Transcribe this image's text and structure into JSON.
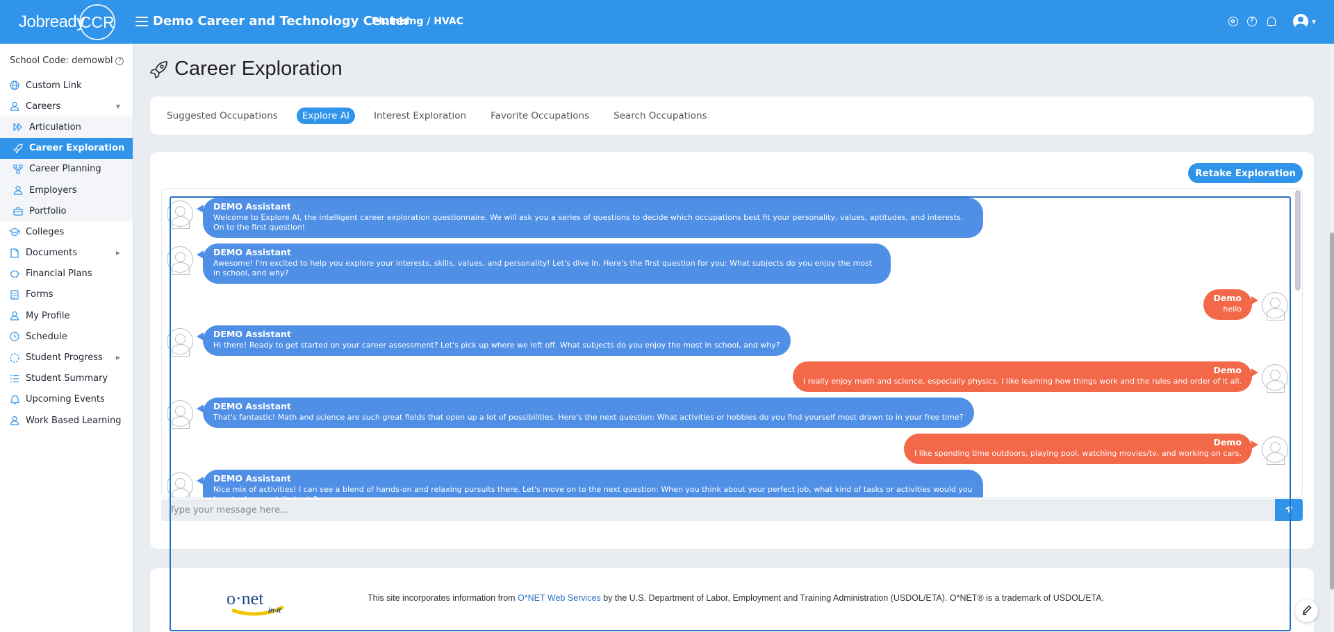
{
  "app": {
    "logo_text": "Jobready",
    "logo_circle_text": "CCR",
    "school_name": "Demo Career and Technology Center",
    "program": "Plumbing / HVAC"
  },
  "sidebar": {
    "school_code": "School Code: demowbl",
    "items": [
      {
        "label": "Custom Link",
        "icon": "globe-icon"
      },
      {
        "label": "Careers",
        "icon": "person-icon",
        "expanded": true
      },
      {
        "label": "Articulation",
        "icon": "play-forward-icon",
        "sub": true
      },
      {
        "label": "Career Exploration",
        "icon": "rocket-icon",
        "sub": true,
        "active": true
      },
      {
        "label": "Career Planning",
        "icon": "flow-chart-icon",
        "sub": true
      },
      {
        "label": "Employers",
        "icon": "person-icon",
        "sub": true
      },
      {
        "label": "Portfolio",
        "icon": "briefcase-icon",
        "sub": true
      },
      {
        "label": "Colleges",
        "icon": "graduation-cap-icon"
      },
      {
        "label": "Documents",
        "icon": "document-icon",
        "caret": true
      },
      {
        "label": "Financial Plans",
        "icon": "piggy-bank-icon"
      },
      {
        "label": "Forms",
        "icon": "form-icon"
      },
      {
        "label": "My Profile",
        "icon": "person-icon"
      },
      {
        "label": "Schedule",
        "icon": "clock-icon"
      },
      {
        "label": "Student Progress",
        "icon": "progress-icon",
        "caret": true
      },
      {
        "label": "Student Summary",
        "icon": "list-icon"
      },
      {
        "label": "Upcoming Events",
        "icon": "bell-icon"
      },
      {
        "label": "Work Based Learning",
        "icon": "person-icon"
      }
    ]
  },
  "page": {
    "title": "Career Exploration",
    "tabs": [
      {
        "label": "Suggested Occupations"
      },
      {
        "label": "Explore AI",
        "active": true
      },
      {
        "label": "Interest Exploration"
      },
      {
        "label": "Favorite Occupations"
      },
      {
        "label": "Search Occupations"
      }
    ],
    "retake_label": "Retake Exploration"
  },
  "chat": {
    "messages": [
      {
        "role": "assistant",
        "name": "DEMO Assistant",
        "text": "Welcome to Explore AI, the intelligent career exploration questionnaire. We will ask you a series of questions to decide which occupations best fit your personality, values, aptitudes, and interests. On to the first question!"
      },
      {
        "role": "assistant",
        "name": "DEMO Assistant",
        "text": "Awesome! I'm excited to help you explore your interests, skills, values, and personality! Let's dive in. Here's the first question for you: What subjects do you enjoy the most in school, and why?"
      },
      {
        "role": "user",
        "name": "Demo",
        "text": "hello"
      },
      {
        "role": "assistant",
        "name": "DEMO Assistant",
        "text": "Hi there! Ready to get started on your career assessment? Let's pick up where we left off. What subjects do you enjoy the most in school, and why?"
      },
      {
        "role": "user",
        "name": "Demo",
        "text": "I really enjoy math and science, especially physics. I like learning how things work and the rules and order of it all."
      },
      {
        "role": "assistant",
        "name": "DEMO Assistant",
        "text": "That's fantastic! Math and science are such great fields that open up a lot of possibilities. Here's the next question: What activities or hobbies do you find yourself most drawn to in your free time?"
      },
      {
        "role": "user",
        "name": "Demo",
        "text": "I like spending time outdoors, playing pool, watching movies/tv, and working on cars."
      },
      {
        "role": "assistant",
        "name": "DEMO Assistant",
        "text": "Nice mix of activities! I can see a blend of hands-on and relaxing pursuits there. Let's move on to the next question: When you think about your perfect job, what kind of tasks or activities would you love to do on a daily basis?"
      }
    ],
    "input_placeholder": "Type your message here..."
  },
  "footer": {
    "logo_text": "o·net",
    "logo_sub": "in·it",
    "text_before": "This site incorporates information from ",
    "link_text": "O*NET Web Services",
    "text_after": " by the U.S. Department of Labor, Employment and Training Administration (USDOL/ETA). O*NET® is a trademark of USDOL/ETA."
  },
  "colors": {
    "primary": "#2f94ea",
    "assistant_bubble": "#4f8fe6",
    "user_bubble": "#f26849"
  }
}
